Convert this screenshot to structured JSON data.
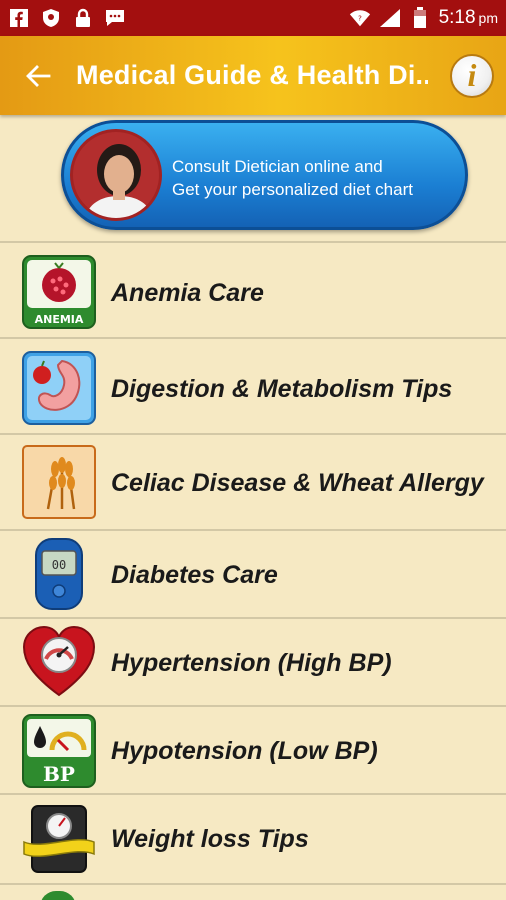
{
  "status_bar": {
    "time": "5:18",
    "time_suffix": "pm"
  },
  "app_bar": {
    "title": "Medical Guide & Health Di...",
    "info_label": "i"
  },
  "banner": {
    "line1": "Consult Dietician online and",
    "line2": "Get your personalized diet chart"
  },
  "items": [
    {
      "label": "Anemia Care",
      "icon": "anemia-icon",
      "icon_text": "ANEMIA"
    },
    {
      "label": "Digestion & Metabolism Tips",
      "icon": "stomach-icon"
    },
    {
      "label": "Celiac Disease & Wheat Allergy",
      "icon": "wheat-icon"
    },
    {
      "label": "Diabetes Care",
      "icon": "glucometer-icon"
    },
    {
      "label": "Hypertension (High BP)",
      "icon": "heart-gauge-icon"
    },
    {
      "label": "Hypotension (Low BP)",
      "icon": "low-bp-icon",
      "icon_text": "BP"
    },
    {
      "label": "Weight loss Tips",
      "icon": "weighing-scale-icon"
    }
  ],
  "colors": {
    "status_bar": "#a30f0f",
    "app_bar": "#f2b51a",
    "background": "#f6e9c3",
    "banner": "#1b7fd3"
  }
}
